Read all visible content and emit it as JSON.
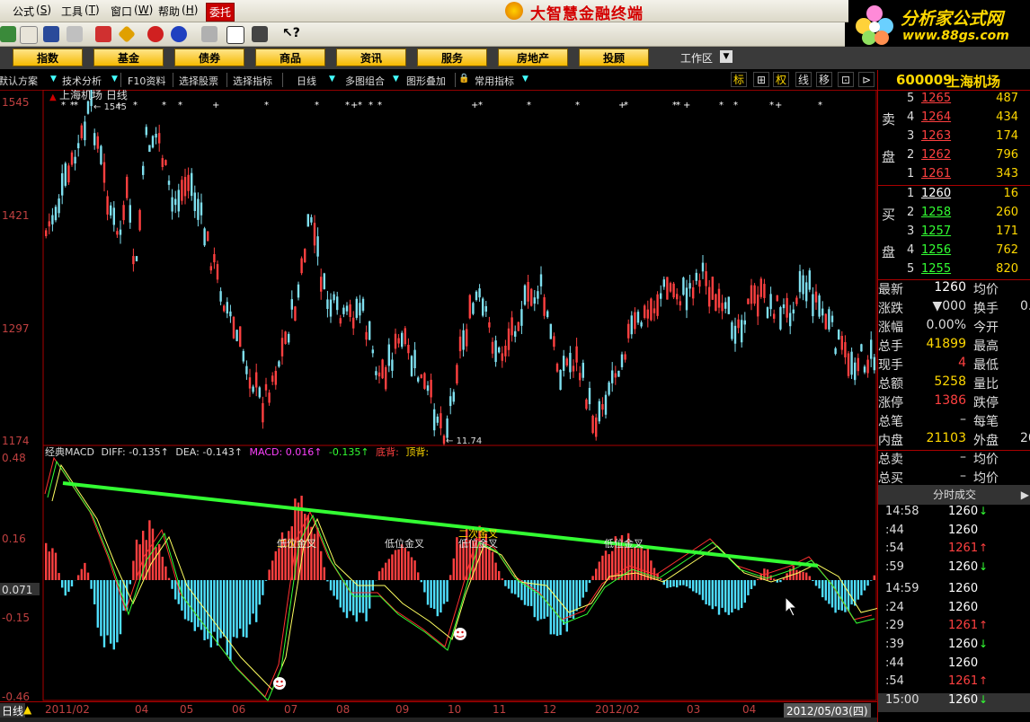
{
  "menu": {
    "formula": "公式",
    "tools": "工具",
    "window": "窗口",
    "help": "帮助",
    "entrust": "委托",
    "title": "大智慧金融终端"
  },
  "logo": {
    "text": "分析家公式网",
    "url": "www.88gs.com"
  },
  "categories": [
    "指数",
    "基金",
    "债券",
    "商品",
    "资讯",
    "服务",
    "房地产",
    "投顾"
  ],
  "workspace": "工作区",
  "funcbar": [
    "默认方案",
    "技术分析",
    "F10资料",
    "选择股票",
    "选择指标",
    "日线",
    "多图组合",
    "图形叠加",
    "常用指标"
  ],
  "right_buttons": [
    "标",
    "⊞",
    "权",
    "线",
    "移",
    "⊡",
    "⊳"
  ],
  "chart": {
    "title": "上海机场 日线",
    "price_ticks": [
      "1545",
      "1421",
      "1297",
      "1174"
    ],
    "high_label": "1545",
    "low_label": "11.74",
    "macd_line": [
      "经典MACD",
      "DIFF: -0.135↑",
      "DEA: -0.143↑",
      "MACD: 0.016↑",
      "-0.135↑",
      "底背:",
      "顶背:"
    ],
    "macd_ticks": [
      "0.48",
      "0.16",
      "0.071",
      "-0.15",
      "-0.46"
    ],
    "annotations": [
      "低位金叉",
      "低位金叉",
      "低位金叉",
      "低位金叉",
      "二次金叉",
      "二次金叉"
    ],
    "dates": [
      "2011/02",
      "04",
      "05",
      "06",
      "07",
      "08",
      "09",
      "10",
      "11",
      "12",
      "2012/02",
      "03",
      "04"
    ],
    "current_date": "2012/05/03(四)",
    "period": "日线"
  },
  "stock": {
    "code": "600009",
    "name": "上海机场"
  },
  "orderbook": {
    "sell_label": [
      "卖",
      "盘"
    ],
    "buy_label": [
      "买",
      "盘"
    ],
    "sells": [
      {
        "lvl": "5",
        "price": "1265",
        "vol": "487"
      },
      {
        "lvl": "4",
        "price": "1264",
        "vol": "434"
      },
      {
        "lvl": "3",
        "price": "1263",
        "vol": "174"
      },
      {
        "lvl": "2",
        "price": "1262",
        "vol": "796"
      },
      {
        "lvl": "1",
        "price": "1261",
        "vol": "343"
      }
    ],
    "buys": [
      {
        "lvl": "1",
        "price": "1260",
        "vol": "16"
      },
      {
        "lvl": "2",
        "price": "1258",
        "vol": "260"
      },
      {
        "lvl": "3",
        "price": "1257",
        "vol": "171"
      },
      {
        "lvl": "4",
        "price": "1256",
        "vol": "762"
      },
      {
        "lvl": "5",
        "price": "1255",
        "vol": "820"
      }
    ]
  },
  "stats": [
    {
      "l": "最新",
      "v": "1260",
      "l2": "均价",
      "v2": ""
    },
    {
      "l": "涨跌",
      "v": "▼000",
      "l2": "换手",
      "v2": "0."
    },
    {
      "l": "涨幅",
      "v": "0.00%",
      "l2": "今开",
      "v2": ""
    },
    {
      "l": "总手",
      "v": "41899",
      "l2": "最高",
      "v2": ""
    },
    {
      "l": "现手",
      "v": "4",
      "l2": "最低",
      "v2": ""
    },
    {
      "l": "总额",
      "v": "5258",
      "l2": "量比",
      "v2": ""
    },
    {
      "l": "涨停",
      "v": "1386",
      "l2": "跌停",
      "v2": ""
    },
    {
      "l": "总笔",
      "v": "–",
      "l2": "每笔",
      "v2": ""
    },
    {
      "l": "内盘",
      "v": "21103",
      "l2": "外盘",
      "v2": "20"
    },
    {
      "l": "总卖",
      "v": "–",
      "l2": "均价",
      "v2": ""
    },
    {
      "l": "总买",
      "v": "–",
      "l2": "均价",
      "v2": ""
    }
  ],
  "ticks_header": "分时成交",
  "ticks": [
    {
      "t": "14:58",
      "p": "1260",
      "a": "↓"
    },
    {
      "t": ":44",
      "p": "1260",
      "a": ""
    },
    {
      "t": ":54",
      "p": "1261",
      "a": "↑"
    },
    {
      "t": ":59",
      "p": "1260",
      "a": "↓"
    },
    {
      "t": "14:59",
      "p": "1260",
      "a": ""
    },
    {
      "t": ":24",
      "p": "1260",
      "a": ""
    },
    {
      "t": ":29",
      "p": "1261",
      "a": "↑"
    },
    {
      "t": ":39",
      "p": "1260",
      "a": "↓"
    },
    {
      "t": ":44",
      "p": "1260",
      "a": ""
    },
    {
      "t": ":54",
      "p": "1261",
      "a": "↑"
    },
    {
      "t": "15:00",
      "p": "1260",
      "a": "↓"
    }
  ],
  "colors": {
    "up": "#ff4040",
    "down": "#4fdfff",
    "trend": "#33ff33",
    "gold": "#ffd800"
  }
}
